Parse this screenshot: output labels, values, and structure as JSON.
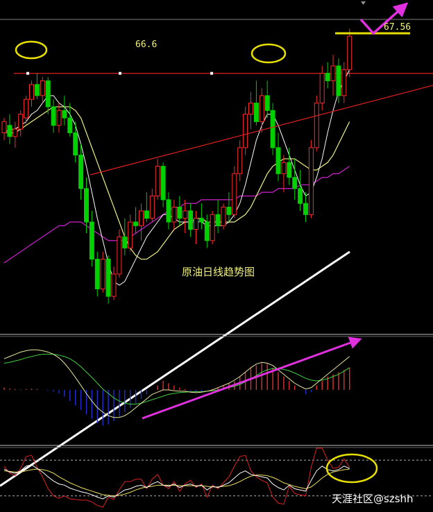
{
  "chart_data": [
    {
      "type": "candlestick",
      "title": "原油日线趋势图",
      "price_labels": {
        "resistance": "66.6",
        "target": "67.56"
      },
      "levels": {
        "resistance": 66.6,
        "target": 67.56
      },
      "ylim": [
        59.8,
        68.2
      ],
      "candles": [
        [
          65.0,
          65.4,
          64.8,
          65.3
        ],
        [
          65.2,
          65.5,
          64.7,
          64.9
        ],
        [
          64.9,
          65.3,
          64.6,
          65.1
        ],
        [
          65.1,
          65.6,
          64.9,
          65.5
        ],
        [
          65.4,
          66.0,
          65.2,
          65.9
        ],
        [
          65.9,
          66.4,
          65.7,
          66.3
        ],
        [
          66.3,
          66.6,
          65.9,
          66.0
        ],
        [
          66.0,
          66.5,
          65.8,
          66.4
        ],
        [
          66.4,
          66.5,
          65.5,
          65.7
        ],
        [
          65.7,
          65.9,
          65.0,
          65.2
        ],
        [
          65.2,
          65.8,
          65.0,
          65.6
        ],
        [
          65.6,
          66.0,
          65.2,
          65.4
        ],
        [
          65.4,
          65.8,
          64.9,
          65.0
        ],
        [
          65.0,
          65.3,
          64.2,
          64.4
        ],
        [
          64.4,
          64.7,
          63.2,
          63.5
        ],
        [
          63.5,
          63.8,
          62.3,
          62.6
        ],
        [
          62.6,
          62.9,
          61.4,
          61.6
        ],
        [
          61.6,
          61.8,
          60.6,
          60.8
        ],
        [
          60.8,
          61.8,
          60.7,
          61.6
        ],
        [
          61.6,
          61.7,
          60.4,
          60.6
        ],
        [
          60.6,
          61.4,
          60.5,
          61.2
        ],
        [
          61.2,
          62.4,
          61.1,
          62.2
        ],
        [
          62.2,
          62.7,
          61.7,
          61.9
        ],
        [
          61.9,
          62.8,
          61.8,
          62.6
        ],
        [
          62.6,
          63.0,
          62.3,
          62.5
        ],
        [
          62.5,
          63.1,
          62.1,
          62.9
        ],
        [
          62.9,
          63.4,
          62.6,
          62.7
        ],
        [
          62.7,
          63.5,
          62.6,
          63.3
        ],
        [
          63.3,
          64.3,
          63.2,
          64.1
        ],
        [
          64.1,
          64.2,
          63.0,
          63.2
        ],
        [
          63.2,
          63.4,
          62.4,
          62.6
        ],
        [
          62.6,
          63.2,
          62.4,
          63.0
        ],
        [
          63.0,
          63.3,
          62.5,
          62.7
        ],
        [
          62.7,
          63.2,
          62.3,
          62.9
        ],
        [
          62.9,
          63.1,
          62.2,
          62.4
        ],
        [
          62.4,
          62.9,
          62.0,
          62.7
        ],
        [
          62.7,
          63.1,
          62.4,
          62.6
        ],
        [
          62.6,
          62.8,
          61.9,
          62.1
        ],
        [
          62.1,
          62.9,
          62.0,
          62.8
        ],
        [
          62.8,
          63.2,
          62.3,
          62.5
        ],
        [
          62.5,
          63.1,
          62.4,
          63.0
        ],
        [
          63.0,
          63.4,
          62.6,
          62.8
        ],
        [
          62.8,
          64.1,
          62.7,
          63.9
        ],
        [
          63.9,
          64.8,
          63.7,
          64.6
        ],
        [
          64.6,
          65.7,
          64.4,
          65.5
        ],
        [
          65.5,
          66.1,
          65.1,
          65.8
        ],
        [
          65.8,
          66.4,
          65.2,
          65.3
        ],
        [
          65.3,
          66.2,
          65.0,
          66.0
        ],
        [
          66.0,
          66.4,
          65.4,
          65.6
        ],
        [
          65.6,
          65.8,
          64.4,
          64.6
        ],
        [
          64.6,
          65.0,
          63.7,
          63.9
        ],
        [
          63.9,
          64.4,
          63.4,
          64.2
        ],
        [
          64.2,
          64.6,
          63.6,
          63.8
        ],
        [
          63.8,
          64.3,
          63.2,
          63.5
        ],
        [
          63.5,
          64.0,
          62.9,
          63.1
        ],
        [
          63.1,
          63.4,
          62.6,
          62.8
        ],
        [
          62.8,
          64.8,
          62.7,
          64.6
        ],
        [
          64.6,
          66.0,
          64.5,
          65.8
        ],
        [
          65.8,
          66.8,
          65.6,
          66.6
        ],
        [
          66.6,
          66.9,
          66.2,
          66.4
        ],
        [
          66.4,
          67.1,
          66.0,
          66.8
        ],
        [
          66.8,
          67.0,
          65.8,
          66.0
        ],
        [
          66.0,
          66.9,
          65.8,
          66.7
        ],
        [
          66.7,
          67.8,
          66.5,
          67.6
        ]
      ],
      "ma5": [
        65.0,
        65.1,
        65.1,
        65.2,
        65.3,
        65.5,
        65.6,
        65.8,
        66.0,
        66.0,
        65.8,
        65.7,
        65.5,
        65.2,
        64.7,
        64.1,
        63.4,
        62.7,
        62.1,
        61.5,
        61.0,
        60.9,
        61.0,
        61.3,
        61.6,
        61.9,
        62.2,
        62.4,
        62.6,
        62.8,
        62.8,
        62.7,
        62.6,
        62.6,
        62.6,
        62.6,
        62.6,
        62.5,
        62.5,
        62.5,
        62.5,
        62.6,
        62.8,
        63.1,
        63.6,
        64.2,
        64.8,
        65.2,
        65.5,
        65.5,
        65.2,
        64.8,
        64.4,
        64.0,
        63.6,
        63.3,
        63.4,
        63.8,
        64.3,
        65.0,
        65.6,
        66.1,
        66.4,
        66.7
      ],
      "ma10": [
        65.0,
        65.0,
        65.0,
        65.1,
        65.2,
        65.3,
        65.4,
        65.5,
        65.6,
        65.7,
        65.7,
        65.7,
        65.7,
        65.6,
        65.4,
        65.0,
        64.6,
        64.2,
        63.8,
        63.4,
        63.0,
        62.6,
        62.2,
        61.9,
        61.7,
        61.6,
        61.6,
        61.7,
        61.8,
        62.0,
        62.2,
        62.4,
        62.5,
        62.6,
        62.6,
        62.7,
        62.7,
        62.6,
        62.6,
        62.6,
        62.6,
        62.6,
        62.6,
        62.7,
        62.8,
        63.0,
        63.3,
        63.6,
        63.9,
        64.1,
        64.2,
        64.3,
        64.3,
        64.3,
        64.2,
        64.1,
        64.0,
        64.0,
        64.1,
        64.2,
        64.4,
        64.7,
        65.0,
        65.3
      ],
      "ma30": [
        61.5,
        61.6,
        61.7,
        61.8,
        61.9,
        62.0,
        62.1,
        62.2,
        62.3,
        62.4,
        62.5,
        62.5,
        62.6,
        62.6,
        62.6,
        62.5,
        62.4,
        62.3,
        62.2,
        62.1,
        62.1,
        62.1,
        62.1,
        62.2,
        62.3,
        62.4,
        62.5,
        62.6,
        62.7,
        62.8,
        62.9,
        63.0,
        63.0,
        63.1,
        63.1,
        63.1,
        63.2,
        63.2,
        63.2,
        63.2,
        63.2,
        63.2,
        63.2,
        63.3,
        63.3,
        63.3,
        63.3,
        63.4,
        63.4,
        63.4,
        63.5,
        63.5,
        63.5,
        63.5,
        63.6,
        63.6,
        63.6,
        63.7,
        63.8,
        63.8,
        63.9,
        63.9,
        64.0,
        64.1
      ],
      "ma_long": [
        55.5,
        55.6,
        55.7,
        55.8,
        55.9,
        56.0,
        56.1,
        56.2,
        56.3,
        56.4,
        56.5,
        56.6,
        56.7,
        56.8,
        56.9,
        57.0,
        57.1,
        57.2,
        57.3,
        57.4,
        57.5,
        57.6,
        57.7,
        57.8,
        57.9,
        58.0,
        58.1,
        58.2,
        58.3,
        58.4,
        58.5,
        58.6,
        58.7,
        58.8,
        58.9,
        59.0,
        59.1,
        59.2,
        59.3,
        59.4,
        59.5,
        59.6,
        59.7,
        59.8,
        59.9,
        60.0,
        60.1,
        60.2,
        60.3,
        60.4,
        60.5,
        60.6,
        60.7,
        60.8,
        60.9,
        61.0,
        61.1,
        61.2,
        61.3,
        61.4,
        61.5,
        61.6,
        61.7,
        61.8
      ]
    },
    {
      "type": "macd",
      "ylim": [
        -1.2,
        1.2
      ],
      "hist": [
        0.05,
        0.03,
        0.02,
        0.01,
        0.02,
        0.03,
        0.02,
        0.0,
        -0.02,
        -0.04,
        -0.08,
        -0.15,
        -0.25,
        -0.35,
        -0.45,
        -0.55,
        -0.65,
        -0.75,
        -0.8,
        -0.78,
        -0.7,
        -0.6,
        -0.5,
        -0.4,
        -0.3,
        -0.2,
        -0.1,
        0.0,
        0.1,
        0.2,
        0.15,
        0.1,
        0.05,
        0.02,
        -0.02,
        -0.05,
        -0.03,
        0.0,
        0.02,
        0.05,
        0.1,
        0.15,
        0.2,
        0.3,
        0.4,
        0.5,
        0.55,
        0.6,
        0.58,
        0.5,
        0.4,
        0.3,
        0.2,
        0.1,
        0.0,
        -0.1,
        -0.05,
        0.1,
        0.2,
        0.3,
        0.35,
        0.4,
        0.45,
        0.5
      ],
      "dif": [
        0.7,
        0.75,
        0.8,
        0.85,
        0.88,
        0.9,
        0.9,
        0.88,
        0.85,
        0.8,
        0.72,
        0.6,
        0.45,
        0.28,
        0.1,
        -0.08,
        -0.25,
        -0.4,
        -0.5,
        -0.58,
        -0.62,
        -0.62,
        -0.58,
        -0.5,
        -0.4,
        -0.3,
        -0.2,
        -0.1,
        -0.05,
        0.0,
        0.0,
        -0.02,
        -0.03,
        -0.03,
        -0.05,
        -0.06,
        -0.05,
        -0.03,
        0.0,
        0.05,
        0.1,
        0.15,
        0.22,
        0.3,
        0.4,
        0.5,
        0.58,
        0.62,
        0.6,
        0.55,
        0.45,
        0.35,
        0.25,
        0.15,
        0.08,
        0.02,
        0.05,
        0.15,
        0.25,
        0.35,
        0.45,
        0.55,
        0.65,
        0.75
      ],
      "dea": [
        0.6,
        0.62,
        0.65,
        0.68,
        0.72,
        0.75,
        0.78,
        0.8,
        0.8,
        0.8,
        0.78,
        0.75,
        0.7,
        0.62,
        0.52,
        0.4,
        0.28,
        0.15,
        0.02,
        -0.08,
        -0.18,
        -0.25,
        -0.3,
        -0.32,
        -0.32,
        -0.3,
        -0.26,
        -0.22,
        -0.18,
        -0.14,
        -0.1,
        -0.08,
        -0.06,
        -0.05,
        -0.04,
        -0.04,
        -0.04,
        -0.03,
        -0.02,
        0.0,
        0.02,
        0.05,
        0.08,
        0.12,
        0.18,
        0.25,
        0.32,
        0.4,
        0.45,
        0.48,
        0.48,
        0.46,
        0.43,
        0.38,
        0.32,
        0.26,
        0.22,
        0.2,
        0.22,
        0.25,
        0.3,
        0.35,
        0.42,
        0.5
      ]
    },
    {
      "type": "oscillator",
      "ylim": [
        0,
        100
      ],
      "levels": [
        80,
        20
      ],
      "k": [
        65,
        60,
        58,
        62,
        70,
        72,
        66,
        60,
        52,
        45,
        40,
        38,
        33,
        30,
        27,
        25,
        22,
        18,
        15,
        20,
        18,
        24,
        30,
        32,
        36,
        38,
        34,
        40,
        44,
        38,
        36,
        40,
        34,
        38,
        40,
        36,
        38,
        30,
        36,
        34,
        38,
        42,
        50,
        58,
        62,
        56,
        54,
        52,
        50,
        40,
        34,
        30,
        38,
        32,
        30,
        28,
        46,
        62,
        70,
        64,
        62,
        64,
        70,
        66
      ],
      "d": [
        62,
        61,
        60,
        60,
        62,
        64,
        65,
        64,
        62,
        58,
        52,
        47,
        42,
        38,
        34,
        31,
        28,
        25,
        22,
        21,
        20,
        21,
        23,
        26,
        30,
        33,
        35,
        36,
        38,
        38,
        38,
        38,
        37,
        37,
        37,
        37,
        37,
        36,
        35,
        35,
        36,
        37,
        40,
        44,
        49,
        53,
        55,
        55,
        54,
        51,
        47,
        42,
        39,
        36,
        34,
        32,
        35,
        42,
        50,
        56,
        60,
        62,
        64,
        65
      ],
      "j": [
        70,
        58,
        54,
        66,
        86,
        88,
        68,
        52,
        32,
        20,
        16,
        20,
        15,
        14,
        13,
        13,
        10,
        4,
        1,
        18,
        14,
        30,
        44,
        44,
        48,
        48,
        32,
        48,
        56,
        38,
        32,
        44,
        28,
        40,
        46,
        34,
        40,
        18,
        38,
        32,
        42,
        52,
        70,
        86,
        88,
        62,
        52,
        46,
        42,
        18,
        8,
        6,
        36,
        24,
        22,
        20,
        68,
        102,
        110,
        80,
        66,
        68,
        82,
        68
      ]
    }
  ],
  "watermark": {
    "text": "天涯社区@szshh"
  },
  "colors": {
    "up": "#ff2a2a",
    "down": "#00d000",
    "ma5": "#ffffff",
    "ma10": "#f0f080",
    "ma30": "#d020d0",
    "ma_long": "#ffffff",
    "trendline": "#e02020",
    "highlight": "#e8e000",
    "arrow": "#e030e0",
    "dif": "#e8e8a0",
    "dea": "#40d040",
    "hist_pos": "#e03030",
    "hist_neg": "#2030d0",
    "k": "#ffffff",
    "d": "#f0e060",
    "j": "#e02020",
    "label": "#f0f080",
    "grid": "#c0c0c0"
  }
}
